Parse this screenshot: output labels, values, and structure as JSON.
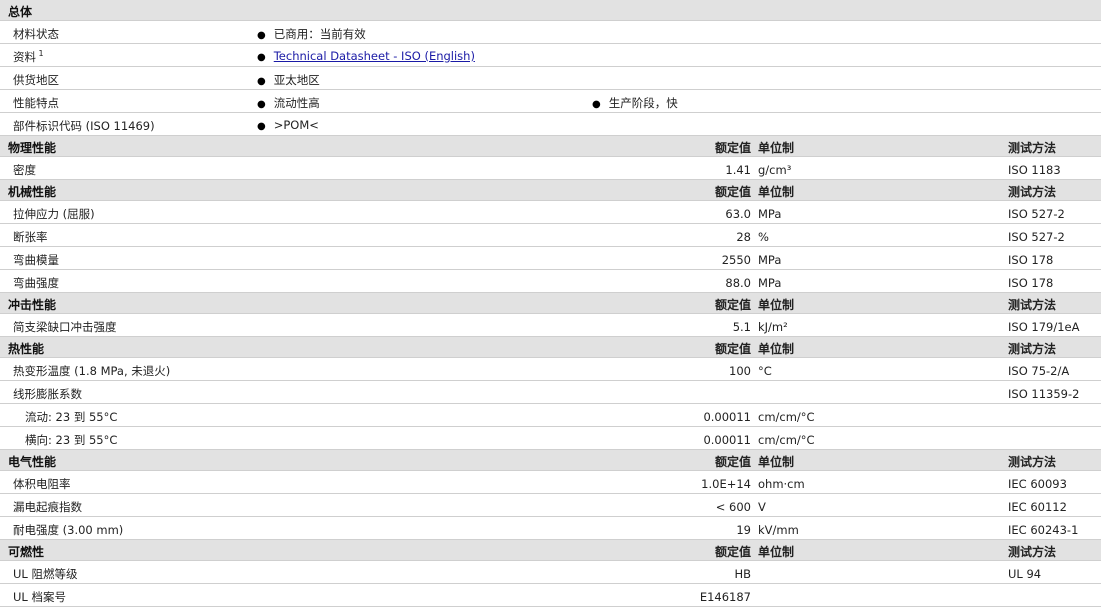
{
  "general": {
    "title": "总体",
    "rows": [
      {
        "name": "材料状态",
        "vals": [
          "已商用：当前有效"
        ]
      },
      {
        "name": "资料",
        "sup": "1",
        "link": "Technical Datasheet - ISO (English)"
      },
      {
        "name": "供货地区",
        "vals": [
          "亚太地区"
        ]
      },
      {
        "name": "性能特点",
        "vals": [
          "流动性高",
          "生产阶段，快"
        ]
      },
      {
        "name": "部件标识代码  (ISO 11469)",
        "vals": [
          ">POM<"
        ]
      }
    ]
  },
  "headers": {
    "nominal": "额定值",
    "unit": "单位制",
    "method": "测试方法"
  },
  "sections": [
    {
      "title": "物理性能",
      "rows": [
        {
          "name": "密度",
          "value": "1.41",
          "unit": "g/cm³",
          "method": "ISO 1183"
        }
      ]
    },
    {
      "title": "机械性能",
      "rows": [
        {
          "name": "拉伸应力  (屈服)",
          "value": "63.0",
          "unit": "MPa",
          "method": "ISO 527-2"
        },
        {
          "name": "断张率",
          "value": "28",
          "unit": "%",
          "method": "ISO 527-2"
        },
        {
          "name": "弯曲模量",
          "value": "2550",
          "unit": "MPa",
          "method": "ISO 178"
        },
        {
          "name": "弯曲强度",
          "value": "88.0",
          "unit": "MPa",
          "method": "ISO 178"
        }
      ]
    },
    {
      "title": "冲击性能",
      "rows": [
        {
          "name": "简支梁缺口冲击强度",
          "value": "5.1",
          "unit": "kJ/m²",
          "method": "ISO 179/1eA"
        }
      ]
    },
    {
      "title": "热性能",
      "rows": [
        {
          "name": "热变形温度  (1.8 MPa, 未退火)",
          "value": "100",
          "unit": "°C",
          "method": "ISO 75-2/A"
        },
        {
          "name": "线形膨胀系数",
          "value": "",
          "unit": "",
          "method": "ISO 11359-2"
        },
        {
          "name": "流动: 23 到  55°C",
          "indent": true,
          "value": "0.00011",
          "unit": "cm/cm/°C",
          "method": ""
        },
        {
          "name": "横向: 23 到  55°C",
          "indent": true,
          "value": "0.00011",
          "unit": "cm/cm/°C",
          "method": ""
        }
      ]
    },
    {
      "title": "电气性能",
      "rows": [
        {
          "name": "体积电阻率",
          "value": "1.0E+14",
          "unit": "ohm·cm",
          "method": "IEC 60093"
        },
        {
          "name": "漏电起痕指数",
          "value": "< 600",
          "unit": "V",
          "method": "IEC 60112"
        },
        {
          "name": "耐电强度  (3.00 mm)",
          "value": "19",
          "unit": "kV/mm",
          "method": "IEC 60243-1"
        }
      ]
    },
    {
      "title": "可燃性",
      "rows": [
        {
          "name": "UL 阻燃等级",
          "value": "HB",
          "unit": "",
          "method": "UL 94"
        },
        {
          "name": "UL 档案号",
          "value": "E146187",
          "unit": "",
          "method": ""
        }
      ]
    }
  ]
}
